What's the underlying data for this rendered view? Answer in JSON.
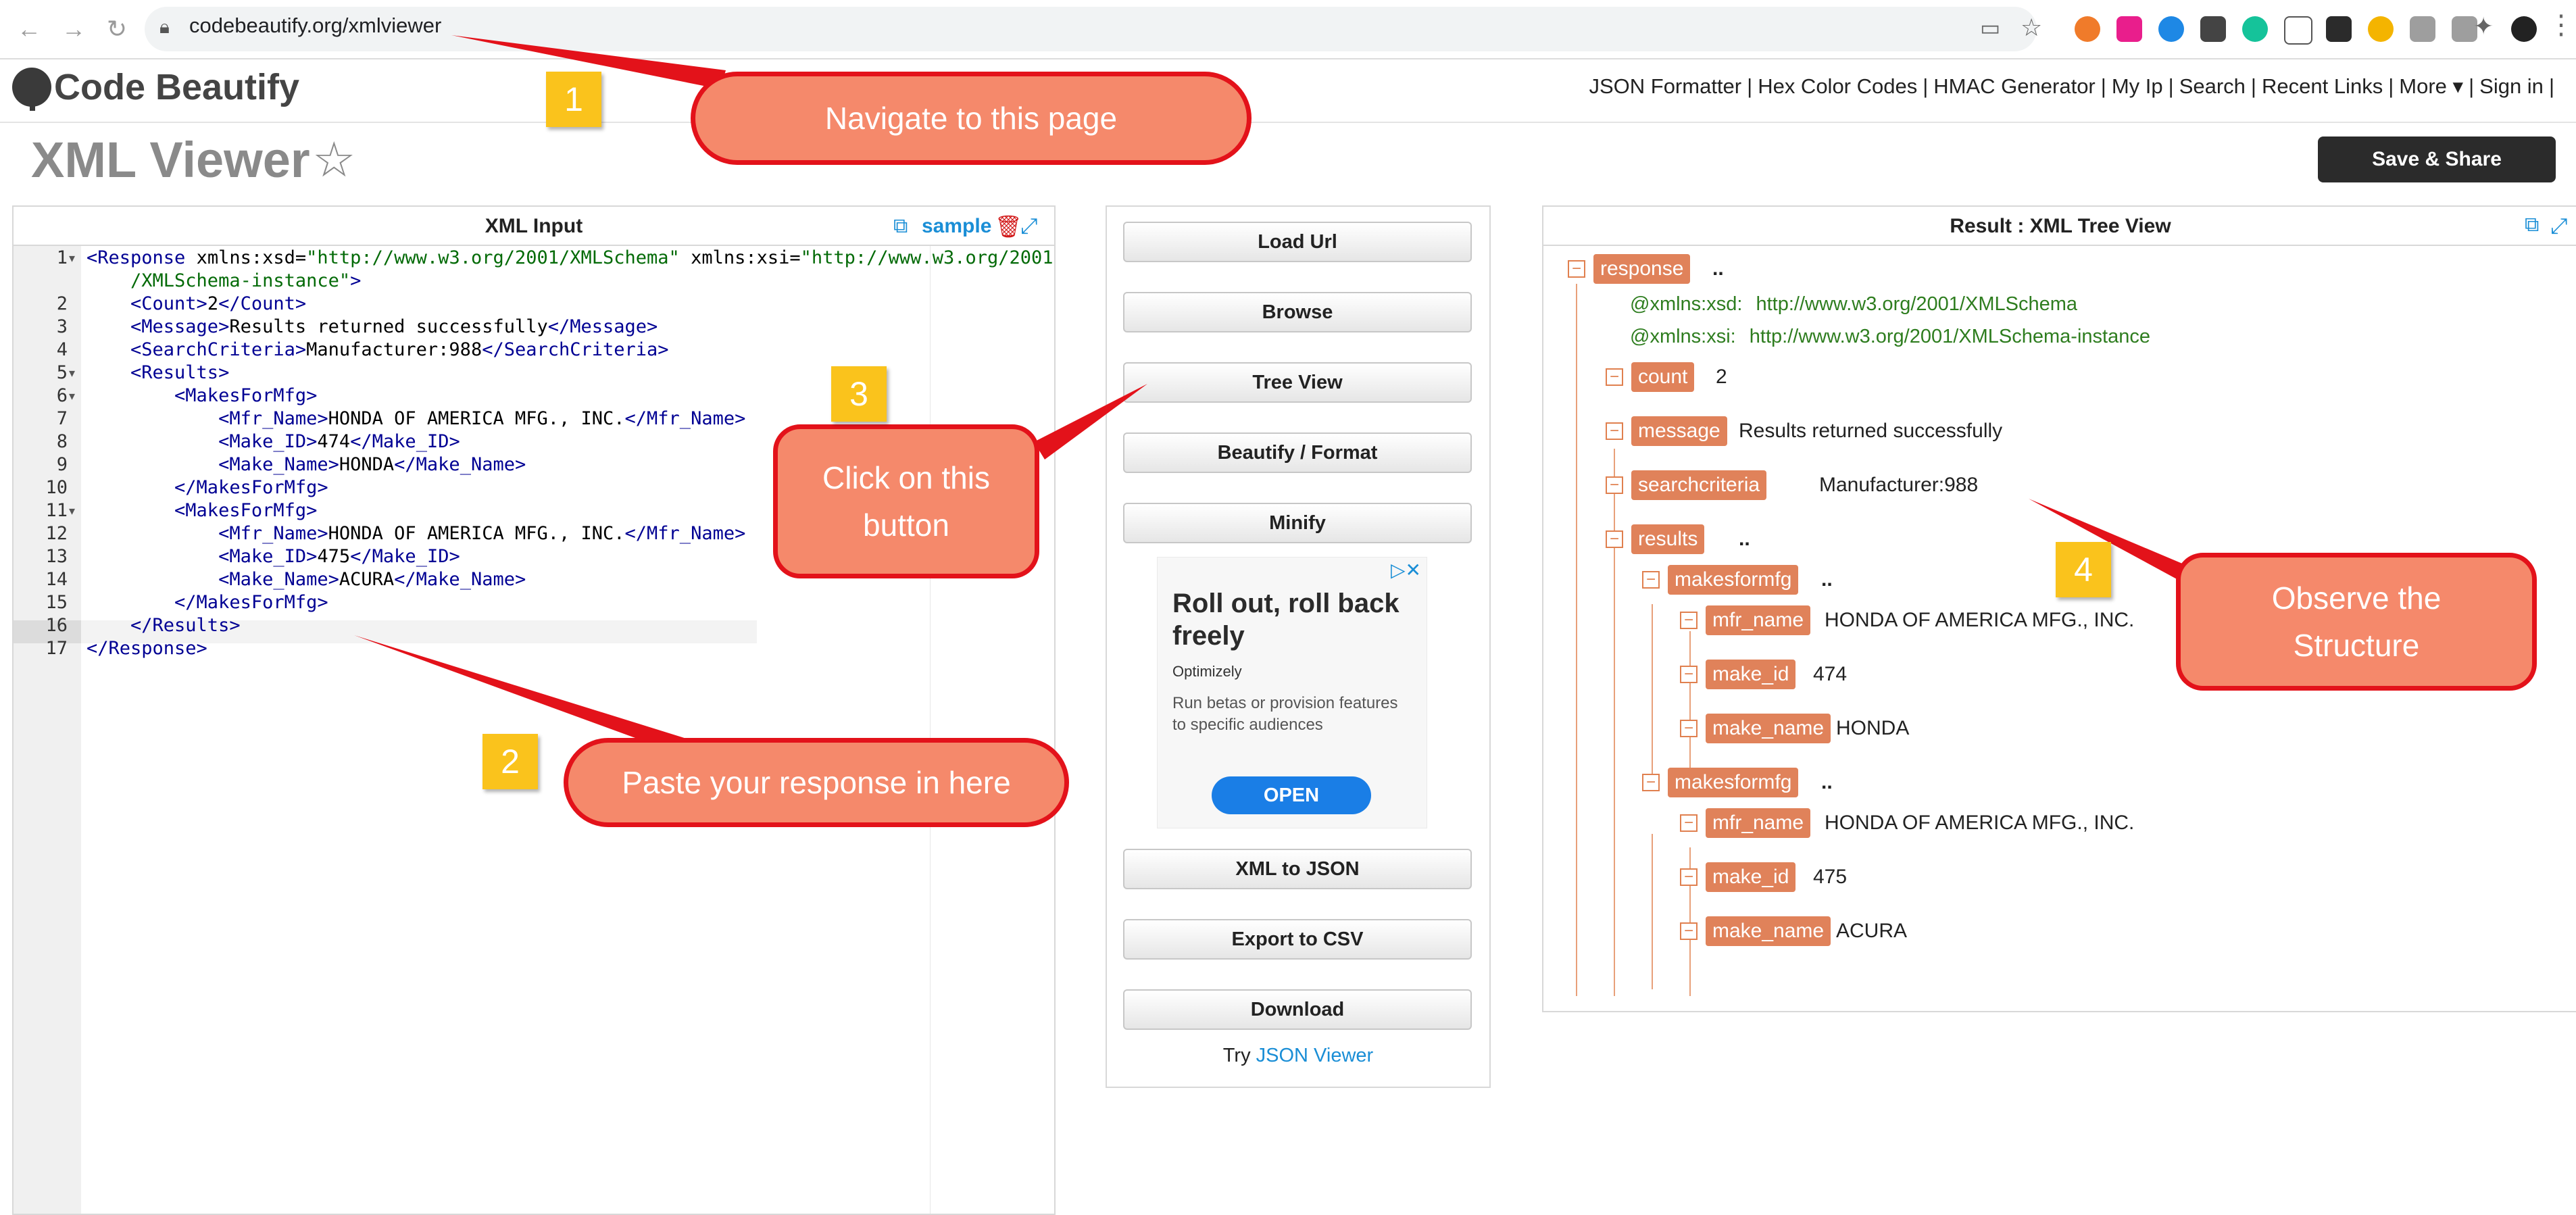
{
  "browser": {
    "url": "codebeautify.org/xmlviewer"
  },
  "site": {
    "logo_text": "Code Beautify",
    "nav": [
      "JSON Formatter",
      "|",
      "Hex Color Codes",
      "|",
      "HMAC Generator",
      "|",
      "My Ip",
      "|",
      "Search",
      "|",
      "Recent Links",
      "|",
      "More ▾",
      "|",
      "Sign in",
      "|"
    ]
  },
  "page": {
    "title": "XML Viewer",
    "save_share": "Save & Share"
  },
  "input_panel": {
    "title": "XML Input",
    "sample_label": "sample",
    "lines": [
      {
        "n": "1",
        "parts": [
          [
            "tg",
            "<Response "
          ],
          [
            "tx",
            "xmlns:xsd="
          ],
          [
            "av",
            "\"http://www.w3.org/2001/XMLSchema\""
          ],
          [
            "tx",
            " xmlns:xsi="
          ],
          [
            "av",
            "\"http://www.w3.org/2001"
          ]
        ]
      },
      {
        "n": "",
        "parts": [
          [
            "av",
            "    /XMLSchema-instance\""
          ],
          [
            "tg",
            ">"
          ]
        ]
      },
      {
        "n": "2",
        "parts": [
          [
            "tg",
            "    <Count>"
          ],
          [
            "tx",
            "2"
          ],
          [
            "tg",
            "</Count>"
          ]
        ]
      },
      {
        "n": "3",
        "parts": [
          [
            "tg",
            "    <Message>"
          ],
          [
            "tx",
            "Results returned successfully"
          ],
          [
            "tg",
            "</Message>"
          ]
        ]
      },
      {
        "n": "4",
        "parts": [
          [
            "tg",
            "    <SearchCriteria>"
          ],
          [
            "tx",
            "Manufacturer:988"
          ],
          [
            "tg",
            "</SearchCriteria>"
          ]
        ]
      },
      {
        "n": "5",
        "parts": [
          [
            "tg",
            "    <Results>"
          ]
        ]
      },
      {
        "n": "6",
        "parts": [
          [
            "tg",
            "        <MakesForMfg>"
          ]
        ]
      },
      {
        "n": "7",
        "parts": [
          [
            "tg",
            "            <Mfr_Name>"
          ],
          [
            "tx",
            "HONDA OF AMERICA MFG., INC."
          ],
          [
            "tg",
            "</Mfr_Name>"
          ]
        ]
      },
      {
        "n": "8",
        "parts": [
          [
            "tg",
            "            <Make_ID>"
          ],
          [
            "tx",
            "474"
          ],
          [
            "tg",
            "</Make_ID>"
          ]
        ]
      },
      {
        "n": "9",
        "parts": [
          [
            "tg",
            "            <Make_Name>"
          ],
          [
            "tx",
            "HONDA"
          ],
          [
            "tg",
            "</Make_Name>"
          ]
        ]
      },
      {
        "n": "10",
        "parts": [
          [
            "tg",
            "        </MakesForMfg>"
          ]
        ]
      },
      {
        "n": "11",
        "parts": [
          [
            "tg",
            "        <MakesForMfg>"
          ]
        ]
      },
      {
        "n": "12",
        "parts": [
          [
            "tg",
            "            <Mfr_Name>"
          ],
          [
            "tx",
            "HONDA OF AMERICA MFG., INC."
          ],
          [
            "tg",
            "</Mfr_Name>"
          ]
        ]
      },
      {
        "n": "13",
        "parts": [
          [
            "tg",
            "            <Make_ID>"
          ],
          [
            "tx",
            "475"
          ],
          [
            "tg",
            "</Make_ID>"
          ]
        ]
      },
      {
        "n": "14",
        "parts": [
          [
            "tg",
            "            <Make_Name>"
          ],
          [
            "tx",
            "ACURA"
          ],
          [
            "tg",
            "</Make_Name>"
          ]
        ]
      },
      {
        "n": "15",
        "parts": [
          [
            "tg",
            "        </MakesForMfg>"
          ]
        ]
      },
      {
        "n": "16",
        "parts": [
          [
            "tg",
            "    </Results>"
          ]
        ]
      },
      {
        "n": "17",
        "parts": [
          [
            "tg",
            "</Response>"
          ]
        ]
      }
    ]
  },
  "middle_panel": {
    "buttons": [
      "Load Url",
      "Browse",
      "Tree View",
      "Beautify / Format",
      "Minify",
      "XML to JSON",
      "Export to CSV",
      "Download"
    ],
    "ad": {
      "headline": "Roll out, roll back freely",
      "brand": "Optimizely",
      "body": "Run betas or provision features to specific audiences",
      "cta": "OPEN"
    },
    "try_prefix": "Try",
    "try_link": "JSON Viewer"
  },
  "result_panel": {
    "title": "Result : XML Tree View",
    "tree": [
      {
        "type": "node",
        "tag": "response",
        "value": "..",
        "depth": 0
      },
      {
        "type": "attr",
        "name": "@xmlns:xsd:",
        "value": "http://www.w3.org/2001/XMLSchema",
        "depth": 1
      },
      {
        "type": "attr",
        "name": "@xmlns:xsi:",
        "value": "http://www.w3.org/2001/XMLSchema-instance",
        "depth": 1
      },
      {
        "type": "node",
        "tag": "count",
        "value": "2",
        "depth": 1
      },
      {
        "type": "node",
        "tag": "message",
        "value": "Results returned successfully",
        "depth": 1
      },
      {
        "type": "node",
        "tag": "searchcriteria",
        "value": "Manufacturer:988",
        "depth": 1
      },
      {
        "type": "node",
        "tag": "results",
        "value": "..",
        "depth": 1
      },
      {
        "type": "node",
        "tag": "makesformfg",
        "value": "..",
        "depth": 2
      },
      {
        "type": "node",
        "tag": "mfr_name",
        "value": "HONDA OF AMERICA MFG., INC.",
        "depth": 3
      },
      {
        "type": "node",
        "tag": "make_id",
        "value": "474",
        "depth": 3
      },
      {
        "type": "node",
        "tag": "make_name",
        "value": "HONDA",
        "depth": 3
      },
      {
        "type": "node",
        "tag": "makesformfg",
        "value": "..",
        "depth": 2
      },
      {
        "type": "node",
        "tag": "mfr_name",
        "value": "HONDA OF AMERICA MFG., INC.",
        "depth": 3
      },
      {
        "type": "node",
        "tag": "make_id",
        "value": "475",
        "depth": 3
      },
      {
        "type": "node",
        "tag": "make_name",
        "value": "ACURA",
        "depth": 3
      }
    ]
  },
  "annotations": {
    "steps": [
      {
        "num": "1",
        "text": "Navigate to this page"
      },
      {
        "num": "2",
        "text": "Paste your response in here"
      },
      {
        "num": "3",
        "text": "Click on this button"
      },
      {
        "num": "4",
        "text": "Observe the Structure"
      }
    ]
  },
  "colors": {
    "tree_tag_bg": "#e0825a",
    "callout_fill": "#f5896b",
    "callout_border": "#e3121a",
    "step_badge": "#fac31c",
    "link_blue": "#1a8ed6"
  }
}
